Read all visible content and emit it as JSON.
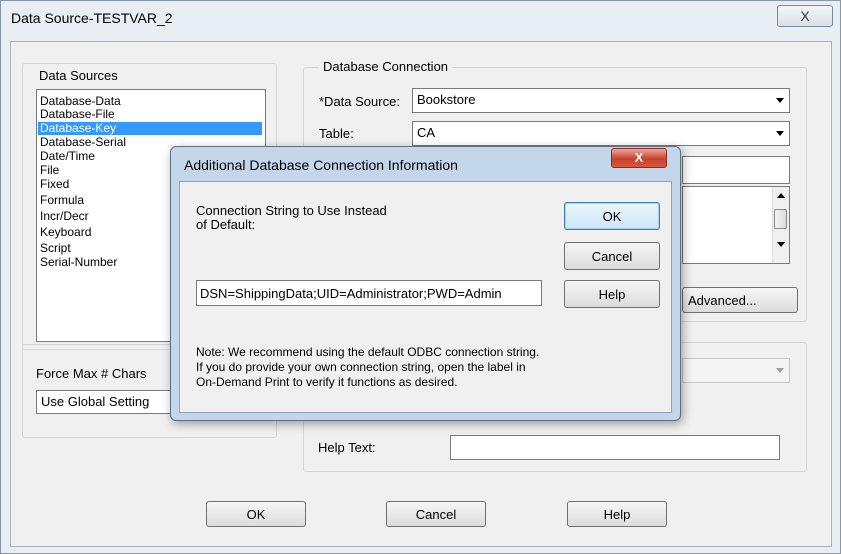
{
  "window": {
    "title": "Data Source-TESTVAR_2",
    "close_glyph": "X"
  },
  "data_sources": {
    "label": "Data Sources",
    "items": [
      "Database-Data",
      "Database-File",
      "Database-Key",
      "Database-Serial",
      "Date/Time",
      "File",
      "Fixed",
      "Formula",
      "Incr/Decr",
      "Keyboard",
      "Script",
      "Serial-Number"
    ],
    "selected": "Database-Key"
  },
  "force_max": {
    "label": "Force Max # Chars",
    "value": "Use Global Setting"
  },
  "db_connection": {
    "label": "Database  Connection",
    "data_source_label": "*Data Source:",
    "data_source_value": "Bookstore",
    "table_label": "Table:",
    "table_value": "CA",
    "advanced_label": "Advanced..."
  },
  "help_text": {
    "label": "Help Text:",
    "value": ""
  },
  "footer": {
    "ok": "OK",
    "cancel": "Cancel",
    "help": "Help"
  },
  "dialog": {
    "title": "Additional Database Connection Information",
    "close_glyph": "X",
    "prompt_line1": "Connection String to Use Instead",
    "prompt_line2": "of Default:",
    "connection_string": "DSN=ShippingData;UID=Administrator;PWD=Admin",
    "ok": "OK",
    "cancel": "Cancel",
    "help": "Help",
    "note_line1": "Note:  We recommend using the default ODBC connection string.",
    "note_line2": "If you do provide your own connection string, open the label in",
    "note_line3": "On-Demand Print to verify it functions as desired."
  },
  "icons": {
    "dropdown": "chevron-down-icon",
    "scroll_up": "scroll-up-icon",
    "scroll_down": "scroll-down-icon"
  },
  "colors": {
    "selection": "#3399ff",
    "close_red": "#c8412b",
    "dialog_frame": "#c4d6ea"
  }
}
